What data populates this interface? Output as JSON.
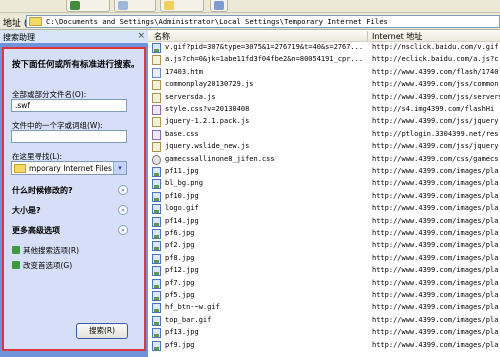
{
  "address_bar": {
    "label": "地址 (D)",
    "path": "C:\\Documents and Settings\\Administrator\\Local Settings\\Temporary Internet Files"
  },
  "search_pane": {
    "title": "搜索助理",
    "close_glyph": "×",
    "heading": "按下面任何或所有标准进行搜索。",
    "filename_label": "全部或部分文件名(O):",
    "filename_value": ".swf",
    "phrase_label": "文件中的一个字或词组(W):",
    "phrase_value": "",
    "lookin_label": "在这里寻找(L):",
    "lookin_value": "mporary Internet Files",
    "when_modified": "什么时候修改的?",
    "size_label": "大小是?",
    "advanced_label": "更多高级选项",
    "other_search": "其他搜索选项(R)",
    "change_prefs": "改变首选项(G)",
    "search_button": "搜索(R)",
    "chevron_glyph": "»",
    "dropdown_glyph": "▾"
  },
  "list": {
    "columns": {
      "name": "名称",
      "address": "Internet 地址"
    },
    "rows": [
      {
        "name": "v.gif?pid=307&type=3075&1=276719&t=40&s=2767...",
        "addr": "http://nsclick.baidu.com/v.gif",
        "icon": "img"
      },
      {
        "name": "a.js?ch=0&jk=1abe11fd3f04fbe2&n=80054191_cpr...",
        "addr": "http://eclick.baidu.com/a.js?c",
        "icon": "js"
      },
      {
        "name": "17403.htm",
        "addr": "http://www.4399.com/flash/1740",
        "icon": "htm"
      },
      {
        "name": "commonplay20130729.js",
        "addr": "http://www.4399.com/jss/common",
        "icon": "js"
      },
      {
        "name": "serversda.js",
        "addr": "http://www.4399.com/jss/servers",
        "icon": "js"
      },
      {
        "name": "style.css?v=20130408",
        "addr": "http://s4.img4399.com/flashHi",
        "icon": "css"
      },
      {
        "name": "jquery-1.2.1.pack.js",
        "addr": "http://www.4399.com/jss/jquery",
        "icon": "js"
      },
      {
        "name": "base.css",
        "addr": "http://ptlogin.3304399.net/res",
        "icon": "css"
      },
      {
        "name": "jquery.wslide_new.js",
        "addr": "http://www.4399.com/jss/jquery",
        "icon": "js"
      },
      {
        "name": "gamecssallinone8_jifen.css",
        "addr": "http://www.4399.com/css/gamecs",
        "icon": "gear"
      },
      {
        "name": "pf11.jpg",
        "addr": "http://www.4399.com/images/pla",
        "icon": "img"
      },
      {
        "name": "bl_bg.png",
        "addr": "http://www.4399.com/images/pla",
        "icon": "img"
      },
      {
        "name": "pf10.jpg",
        "addr": "http://www.4399.com/images/pla",
        "icon": "img"
      },
      {
        "name": "logo.gif",
        "addr": "http://www.4399.com/images/pla",
        "icon": "img"
      },
      {
        "name": "pf14.jpg",
        "addr": "http://www.4399.com/images/pla",
        "icon": "img"
      },
      {
        "name": "pf6.jpg",
        "addr": "http://www.4399.com/images/pla",
        "icon": "img"
      },
      {
        "name": "pf2.jpg",
        "addr": "http://www.4399.com/images/pla",
        "icon": "img"
      },
      {
        "name": "pf8.jpg",
        "addr": "http://www.4399.com/images/pla",
        "icon": "img"
      },
      {
        "name": "pf12.jpg",
        "addr": "http://www.4399.com/images/pla",
        "icon": "img"
      },
      {
        "name": "pf7.jpg",
        "addr": "http://www.4399.com/images/pla",
        "icon": "img"
      },
      {
        "name": "pf5.jpg",
        "addr": "http://www.4399.com/images/pla",
        "icon": "img"
      },
      {
        "name": "hf_btn-~w.gif",
        "addr": "http://www.4399.com/images/pla",
        "icon": "img"
      },
      {
        "name": "top_bar.gif",
        "addr": "http://www.4399.com/images/pla",
        "icon": "img"
      },
      {
        "name": "pf13.jpg",
        "addr": "http://www.4399.com/images/pla",
        "icon": "img"
      },
      {
        "name": "pf9.jpg",
        "addr": "http://www.4399.com/images/pla",
        "icon": "img"
      }
    ]
  }
}
